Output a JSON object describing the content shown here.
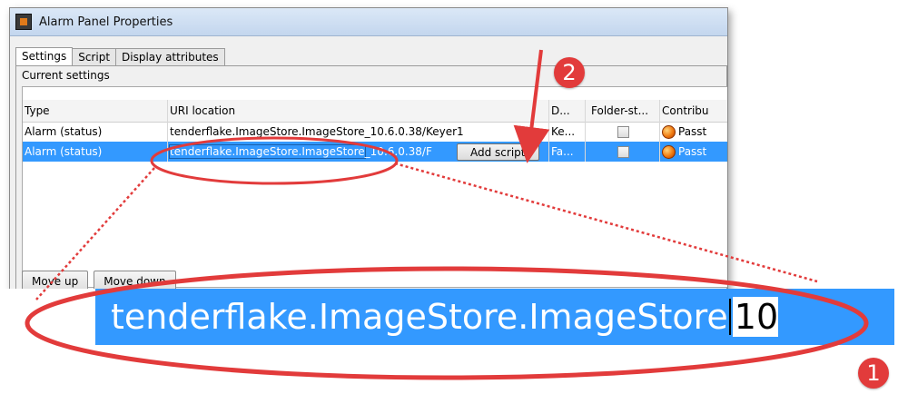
{
  "window": {
    "title": "Alarm Panel Properties"
  },
  "tabs": [
    {
      "label": "Settings"
    },
    {
      "label": "Script"
    },
    {
      "label": "Display attributes"
    }
  ],
  "group": {
    "label": "Current settings"
  },
  "table": {
    "headers": {
      "type": "Type",
      "uri": "URI location",
      "d": "D...",
      "folder": "Folder-st...",
      "contrib": "Contribu"
    },
    "rows": [
      {
        "type": "Alarm (status)",
        "uri": "tenderflake.ImageStore.ImageStore_10.6.0.38/Keyer1",
        "d": "Ke...",
        "folder_checked": false,
        "contrib": "Passt"
      },
      {
        "type": "Alarm (status)",
        "uri_selected": "tenderflake.ImageStore.ImageStore",
        "uri_rest": "_10.6.0.38/F",
        "add_script": "Add script",
        "d": "Fa...",
        "folder_checked": false,
        "contrib": "Passt"
      }
    ]
  },
  "buttons": {
    "move_up": "Move up",
    "move_down": "Move down"
  },
  "zoom": {
    "selected": "tenderflake.ImageStore.ImageStore",
    "rest": "10"
  },
  "callouts": {
    "one": "1",
    "two": "2"
  },
  "colors": {
    "selection": "#3399ff",
    "annotation": "#e23b3b"
  }
}
